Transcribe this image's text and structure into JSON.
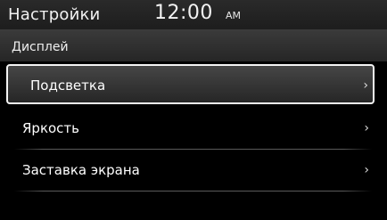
{
  "status_bar": {
    "title": "Настройки",
    "clock": "12:00",
    "ampm": "AM"
  },
  "section": {
    "title": "Дисплей"
  },
  "menu": {
    "items": [
      {
        "label": "Подсветка",
        "chevron": "›",
        "selected": true
      },
      {
        "label": "Яркость",
        "chevron": "›",
        "selected": false
      },
      {
        "label": "Заставка экрана",
        "chevron": "›",
        "selected": false
      }
    ]
  },
  "colors": {
    "background": "#000000",
    "selection_border": "#f4f4f4",
    "text": "#ffffff"
  }
}
